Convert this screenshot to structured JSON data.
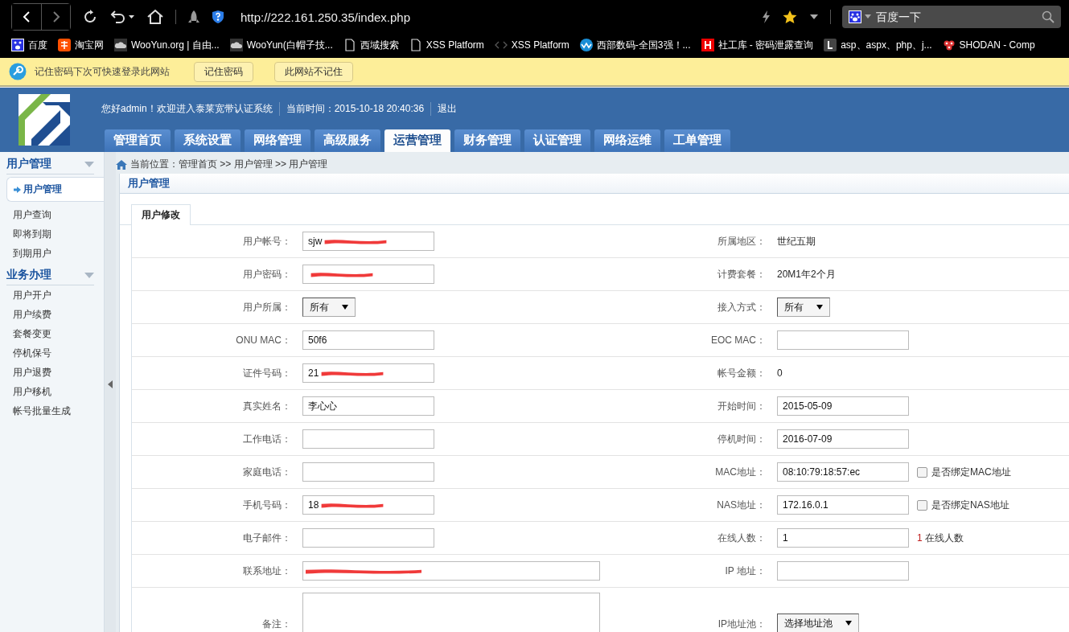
{
  "browser": {
    "url": "http://222.161.250.35/index.php",
    "search_placeholder": "百度一下"
  },
  "bookmarks": [
    {
      "label": "百度",
      "kind": "paw"
    },
    {
      "label": "淘宝网",
      "kind": "tao"
    },
    {
      "label": "WooYun.org | 自由...",
      "kind": "cloud"
    },
    {
      "label": "WooYun(白帽子技...",
      "kind": "cloud"
    },
    {
      "label": "西域搜索",
      "kind": "page"
    },
    {
      "label": "XSS Platform",
      "kind": "page"
    },
    {
      "label": "XSS Platform",
      "kind": "code"
    },
    {
      "label": "西部数码-全国3强！...",
      "kind": "wave"
    },
    {
      "label": "社工库 - 密码泄露查询",
      "kind": "h"
    },
    {
      "label": "asp、aspx、php、j...",
      "kind": "l"
    },
    {
      "label": "SHODAN - Comp",
      "kind": "dots"
    }
  ],
  "password_bar": {
    "message": "记住密码下次可快速登录此网站",
    "buttons": [
      "记住密码",
      "此网站不记住"
    ]
  },
  "header": {
    "greeting": "您好admin！欢迎进入泰莱宽带认证系统",
    "time": "当前时间：2015-10-18 20:40:36",
    "logout": "退出"
  },
  "tabs": [
    {
      "label": "管理首页",
      "selected": false
    },
    {
      "label": "系统设置",
      "selected": false
    },
    {
      "label": "网络管理",
      "selected": false
    },
    {
      "label": "高级服务",
      "selected": false
    },
    {
      "label": "运营管理",
      "selected": true
    },
    {
      "label": "财务管理",
      "selected": false
    },
    {
      "label": "认证管理",
      "selected": false
    },
    {
      "label": "网络运维",
      "selected": false
    },
    {
      "label": "工单管理",
      "selected": false
    }
  ],
  "sidebar": [
    {
      "title": "用户管理",
      "items": [
        {
          "label": "用户管理",
          "selected": true
        },
        {
          "label": "用户查询",
          "selected": false
        },
        {
          "label": "即将到期",
          "selected": false
        },
        {
          "label": "到期用户",
          "selected": false
        }
      ]
    },
    {
      "title": "业务办理",
      "items": [
        {
          "label": "用户开户",
          "selected": false
        },
        {
          "label": "用户续费",
          "selected": false
        },
        {
          "label": "套餐变更",
          "selected": false
        },
        {
          "label": "停机保号",
          "selected": false
        },
        {
          "label": "用户退费",
          "selected": false
        },
        {
          "label": "用户移机",
          "selected": false
        },
        {
          "label": "帐号批量生成",
          "selected": false
        }
      ]
    }
  ],
  "breadcrumb": "当前位置：管理首页 >> 用户管理 >> 用户管理",
  "panel_title": "用户管理",
  "form_tab": "用户修改",
  "rows": [
    [
      {
        "label": "用户帐号：",
        "kind": "input",
        "value": "sjw",
        "redacted": true
      },
      {
        "label": "所属地区：",
        "kind": "static",
        "value": "世纪五期"
      }
    ],
    [
      {
        "label": "用户密码：",
        "kind": "input",
        "redacted": true
      },
      {
        "label": "计费套餐：",
        "kind": "static",
        "value": "20M1年2个月"
      }
    ],
    [
      {
        "label": "用户所属：",
        "kind": "select",
        "value": "所有"
      },
      {
        "label": "接入方式：",
        "kind": "select",
        "value": "所有"
      }
    ],
    [
      {
        "label": "ONU MAC：",
        "kind": "input",
        "value": "50f6"
      },
      {
        "label": "EOC MAC：",
        "kind": "input"
      }
    ],
    [
      {
        "label": "证件号码：",
        "kind": "input",
        "value": "21",
        "redacted": true
      },
      {
        "label": "帐号金额：",
        "kind": "static",
        "value": "0"
      }
    ],
    [
      {
        "label": "真实姓名：",
        "kind": "input",
        "value": "李心心"
      },
      {
        "label": "开始时间：",
        "kind": "input",
        "value": "2015-05-09"
      }
    ],
    [
      {
        "label": "工作电话：",
        "kind": "input"
      },
      {
        "label": "停机时间：",
        "kind": "input",
        "value": "2016-07-09"
      }
    ],
    [
      {
        "label": "家庭电话：",
        "kind": "input"
      },
      {
        "label": "MAC地址：",
        "kind": "input",
        "value": "08:10:79:18:57:ec",
        "checkbox": {
          "label": "是否绑定MAC地址",
          "checked": false
        }
      }
    ],
    [
      {
        "label": "手机号码：",
        "kind": "input",
        "value": "18",
        "redacted": true
      },
      {
        "label": "NAS地址：",
        "kind": "input",
        "value": "172.16.0.1",
        "checkbox": {
          "label": "是否绑定NAS地址",
          "checked": false
        }
      }
    ],
    [
      {
        "label": "电子邮件：",
        "kind": "input"
      },
      {
        "label": "在线人数：",
        "kind": "input",
        "value": "1",
        "note": {
          "count": "1",
          "text": "在线人数"
        }
      }
    ],
    [
      {
        "label": "联系地址：",
        "kind": "wide",
        "redacted": true
      },
      {
        "label": "IP 地址：",
        "kind": "input"
      }
    ],
    [
      {
        "label": "备注：",
        "kind": "textarea"
      },
      {
        "label": "IP地址池：",
        "kind": "select",
        "value": "选择地址池"
      }
    ]
  ]
}
